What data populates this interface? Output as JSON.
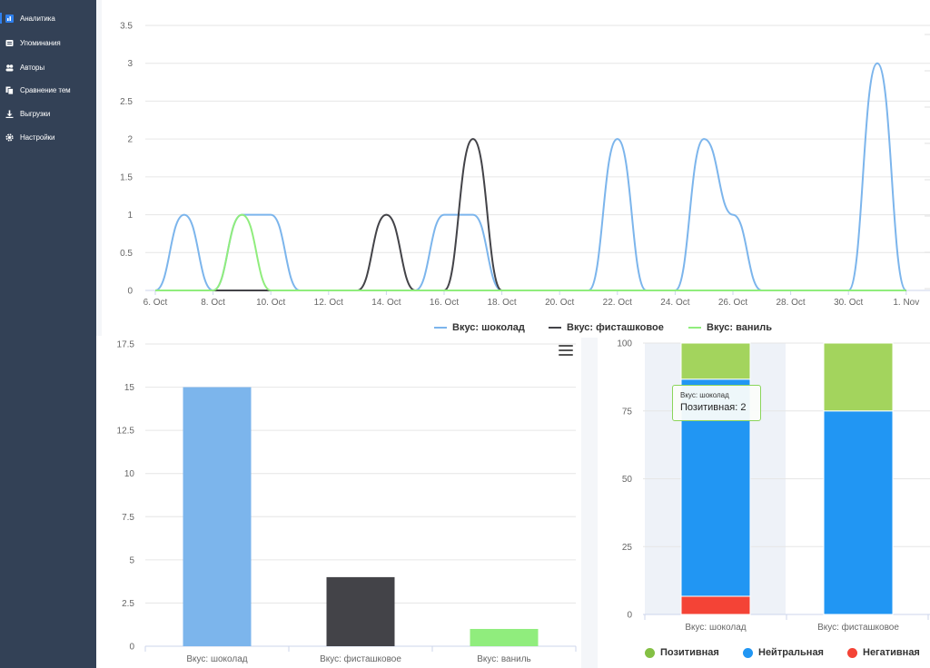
{
  "sidebar": {
    "items": [
      {
        "label": "Аналитика",
        "icon": "analytics-icon",
        "active": true
      },
      {
        "label": "Упоминания",
        "icon": "mentions-icon",
        "active": false
      },
      {
        "label": "Авторы",
        "icon": "authors-icon",
        "active": false
      },
      {
        "label": "Сравнение тем",
        "icon": "compare-icon",
        "active": false
      },
      {
        "label": "Выгрузки",
        "icon": "download-icon",
        "active": false
      },
      {
        "label": "Настройки",
        "icon": "gear-icon",
        "active": false
      }
    ]
  },
  "tooltip": {
    "series": "Вкус: шоколад",
    "text": "Позитивная: 2"
  },
  "legend_line": [
    {
      "label": "Вкус: шоколад",
      "color": "#7cb5ec"
    },
    {
      "label": "Вкус: фисташковое",
      "color": "#434348"
    },
    {
      "label": "Вкус: ваниль",
      "color": "#90ed7d"
    }
  ],
  "legend_sentiment": [
    {
      "label": "Позитивная",
      "color": "#84c044"
    },
    {
      "label": "Нейтральная",
      "color": "#2196f3"
    },
    {
      "label": "Негативная",
      "color": "#f44336"
    }
  ],
  "chart_data": [
    {
      "type": "line",
      "title": "",
      "x": [
        "6. Oct",
        "7. Oct",
        "8. Oct",
        "9. Oct",
        "10. Oct",
        "11. Oct",
        "12. Oct",
        "13. Oct",
        "14. Oct",
        "15. Oct",
        "16. Oct",
        "17. Oct",
        "18. Oct",
        "19. Oct",
        "20. Oct",
        "21. Oct",
        "22. Oct",
        "23. Oct",
        "24. Oct",
        "25. Oct",
        "26. Oct",
        "27. Oct",
        "28. Oct",
        "29. Oct",
        "30. Oct",
        "31. Oct",
        "1. Nov"
      ],
      "x_tick_labels": [
        "6. Oct",
        "8. Oct",
        "10. Oct",
        "12. Oct",
        "14. Oct",
        "16. Oct",
        "18. Oct",
        "20. Oct",
        "22. Oct",
        "24. Oct",
        "26. Oct",
        "28. Oct",
        "30. Oct",
        "1. Nov"
      ],
      "ylim": [
        0,
        3.5
      ],
      "y_ticks": [
        "0",
        "0.5",
        "1",
        "1.5",
        "2",
        "2.5",
        "3",
        "3.5"
      ],
      "series": [
        {
          "name": "Вкус: шоколад",
          "color": "#7cb5ec",
          "values": [
            0,
            1,
            0,
            1,
            1,
            0,
            0,
            0,
            0,
            0,
            1,
            1,
            0,
            0,
            0,
            0,
            2,
            0,
            0,
            2,
            1,
            0,
            0,
            0,
            0,
            3,
            0
          ]
        },
        {
          "name": "Вкус: фисташковое",
          "color": "#434348",
          "values": [
            0,
            0,
            0,
            0,
            0,
            0,
            0,
            0,
            1,
            0,
            0,
            2,
            0,
            0,
            0,
            0,
            0,
            0,
            0,
            0,
            0,
            0,
            0,
            0,
            0,
            0,
            0
          ]
        },
        {
          "name": "Вкус: ваниль",
          "color": "#90ed7d",
          "values": [
            0,
            0,
            0,
            1,
            0,
            0,
            0,
            0,
            0,
            0,
            0,
            0,
            0,
            0,
            0,
            0,
            0,
            0,
            0,
            0,
            0,
            0,
            0,
            0,
            0,
            0,
            0
          ]
        }
      ]
    },
    {
      "type": "bar",
      "title": "",
      "categories": [
        "Вкус: шоколад",
        "Вкус: фисташковое",
        "Вкус: ваниль"
      ],
      "values": [
        15,
        4,
        1
      ],
      "colors": [
        "#7cb5ec",
        "#434348",
        "#90ed7d"
      ],
      "ylim": [
        0,
        17.5
      ],
      "y_ticks": [
        "0",
        "2.5",
        "5",
        "7.5",
        "10",
        "12.5",
        "15",
        "17.5"
      ]
    },
    {
      "type": "bar",
      "stacked_percent": true,
      "title": "",
      "categories": [
        "Вкус: шоколад",
        "Вкус: фисташковое"
      ],
      "ylim": [
        0,
        100
      ],
      "y_ticks": [
        "0",
        "25",
        "50",
        "75",
        "100"
      ],
      "series": [
        {
          "name": "Позитивная",
          "color": "#a3d45d",
          "values": [
            13.3,
            25
          ]
        },
        {
          "name": "Нейтральная",
          "color": "#2196f3",
          "values": [
            80,
            75
          ]
        },
        {
          "name": "Негативная",
          "color": "#f44336",
          "values": [
            6.7,
            0
          ]
        }
      ]
    }
  ]
}
